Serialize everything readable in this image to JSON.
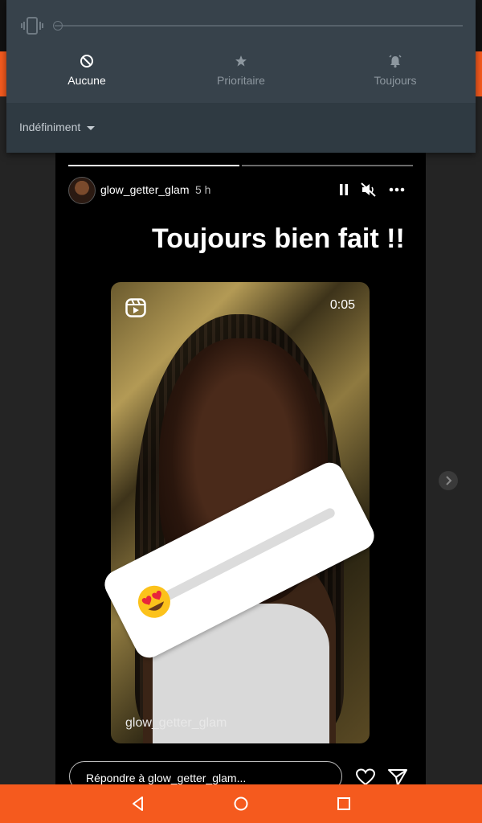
{
  "dnd": {
    "modes": [
      {
        "label": "Aucune",
        "icon": "block-icon",
        "active": true
      },
      {
        "label": "Prioritaire",
        "icon": "star-icon",
        "active": false
      },
      {
        "label": "Toujours",
        "icon": "alarm-bell-icon",
        "active": false
      }
    ],
    "duration_label": "Indéfiniment",
    "volume_level": 0
  },
  "story": {
    "username": "glow_getter_glam",
    "time": "5 h",
    "caption": "Toujours bien fait !!",
    "progress": [
      1.0,
      0.0
    ],
    "reel": {
      "duration": "0:05",
      "watermark": "glow_getter_glam"
    },
    "slider_emoji": "😍",
    "reply_placeholder": "Répondre à glow_getter_glam..."
  },
  "colors": {
    "accent": "#f55a1e",
    "panel": "#37424b",
    "panel_dark": "#2f3a42",
    "story_bg": "#000000"
  }
}
